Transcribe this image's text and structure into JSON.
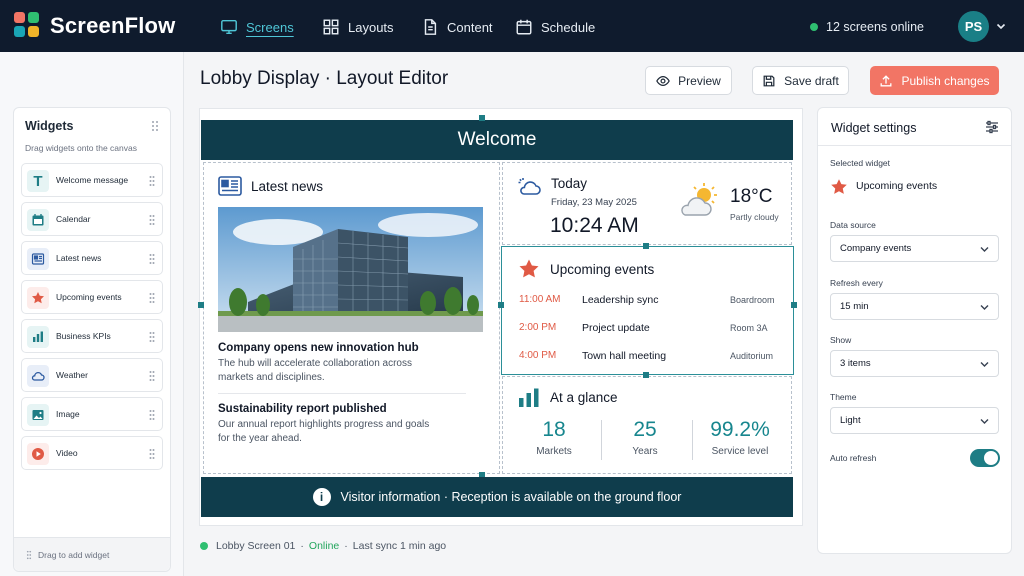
{
  "app": {
    "name": "ScreenFlow"
  },
  "nav": [
    {
      "label": "Screens",
      "icon": "monitor-icon"
    },
    {
      "label": "Layouts",
      "icon": "grid-icon"
    },
    {
      "label": "Content",
      "icon": "document-icon"
    },
    {
      "label": "Schedule",
      "icon": "calendar-icon"
    }
  ],
  "header_status": {
    "online": "12 screens online",
    "avatar_initials": "PS"
  },
  "widgets_panel": {
    "title": "Widgets",
    "subtitle": "Drag widgets onto the canvas",
    "items": [
      {
        "label": "Welcome message",
        "icon": "text-icon"
      },
      {
        "label": "Calendar",
        "icon": "calendar-icon"
      },
      {
        "label": "Latest news",
        "icon": "news-icon"
      },
      {
        "label": "Upcoming events",
        "icon": "star-icon"
      },
      {
        "label": "Business KPIs",
        "icon": "bar-chart-icon"
      },
      {
        "label": "Weather",
        "icon": "cloud-icon"
      },
      {
        "label": "Image",
        "icon": "image-icon"
      },
      {
        "label": "Video",
        "icon": "play-icon"
      }
    ],
    "drag_hint": "Drag to add widget"
  },
  "editor": {
    "title": "Lobby Display · Layout Editor",
    "preview_label": "Preview",
    "save_label": "Save draft",
    "publish_label": "Publish changes"
  },
  "canvas": {
    "welcome": "Welcome",
    "news": {
      "title": "Latest news",
      "items": [
        {
          "headline": "Company opens new innovation hub",
          "body": "The hub will accelerate collaboration across markets and disciplines."
        },
        {
          "headline": "Sustainability report published",
          "body": "Our annual report highlights progress and goals for the year ahead."
        }
      ]
    },
    "today": {
      "title": "Today",
      "date": "Friday, 23 May 2025",
      "time": "10:24 AM",
      "temp": "18°C",
      "condition": "Partly cloudy"
    },
    "events": {
      "title": "Upcoming events",
      "items": [
        {
          "time": "11:00 AM",
          "name": "Leadership sync",
          "room": "Boardroom"
        },
        {
          "time": "2:00 PM",
          "name": "Project update",
          "room": "Room 3A"
        },
        {
          "time": "4:00 PM",
          "name": "Town hall meeting",
          "room": "Auditorium"
        }
      ]
    },
    "glance": {
      "title": "At a glance",
      "kpis": [
        {
          "value": "18",
          "label": "Markets"
        },
        {
          "value": "25",
          "label": "Years"
        },
        {
          "value": "99.2%",
          "label": "Service level"
        }
      ]
    },
    "footer": "Visitor information · Reception is available on the ground floor"
  },
  "status_bar": {
    "screen": "Lobby Screen 01",
    "sep": "·",
    "state": "Online",
    "sync": "Last sync 1 min ago"
  },
  "settings": {
    "title": "Widget settings",
    "selected_label": "Selected widget",
    "selected_value": "Upcoming events",
    "fields": [
      {
        "label": "Data source",
        "value": "Company events"
      },
      {
        "label": "Refresh every",
        "value": "15 min"
      },
      {
        "label": "Show",
        "value": "3 items"
      },
      {
        "label": "Theme",
        "value": "Light"
      }
    ],
    "auto_refresh_label": "Auto refresh",
    "auto_refresh_on": true
  },
  "colors": {
    "nav_bg": "#0f1b2d",
    "accent": "#1e7d85",
    "primary_button": "#f27565",
    "banner": "#0f3d4c",
    "event_time": "#e05a45"
  }
}
